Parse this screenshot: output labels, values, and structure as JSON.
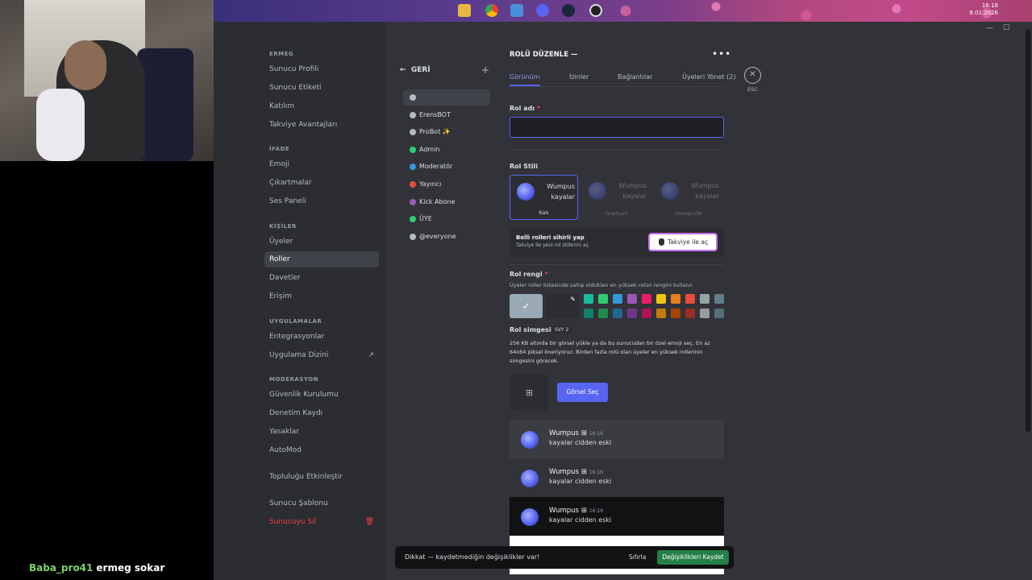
{
  "taskbar": {
    "time": "16:18",
    "date": "8.01.2026"
  },
  "stream": {
    "chat_user": "Baba_pro41",
    "chat_message": "ermeg sokar"
  },
  "sidebar": {
    "sections": [
      {
        "title": "ERMEG",
        "items": [
          "Sunucu Profili",
          "Sunucu Etiketi",
          "Katılım",
          "Takviye Avantajları"
        ]
      },
      {
        "title": "İFADE",
        "items": [
          "Emoji",
          "Çıkartmalar",
          "Ses Paneli"
        ]
      },
      {
        "title": "KİŞİLER",
        "items": [
          "Üyeler",
          "Roller",
          "Davetler",
          "Erişim"
        ]
      },
      {
        "title": "UYGULAMALAR",
        "items": [
          "Entegrasyonlar",
          "Uygulama Dizini"
        ]
      },
      {
        "title": "MODERASYON",
        "items": [
          "Güvenlik Kurulumu",
          "Denetim Kaydı",
          "Yasaklar",
          "AutoMod"
        ]
      },
      {
        "title": "",
        "items": [
          "Topluluğu Etkinleştir"
        ]
      },
      {
        "title": "",
        "items": [
          "Sunucu Şablonu",
          "Sunucuyu Sil"
        ]
      }
    ],
    "active_item": "Roller"
  },
  "roles": {
    "back_label": "GERİ",
    "items": [
      {
        "name": "",
        "color": "#b5bac1"
      },
      {
        "name": "ErensBOT",
        "color": "#b5bac1"
      },
      {
        "name": "ProBot ✨",
        "color": "#b5bac1"
      },
      {
        "name": "Admin",
        "color": "#2ecc71"
      },
      {
        "name": "Moderatör",
        "color": "#3498db"
      },
      {
        "name": "Yayıncı",
        "color": "#e74c3c"
      },
      {
        "name": "Kick Abone",
        "color": "#9b59b6"
      },
      {
        "name": "ÜYE",
        "color": "#2ecc71"
      },
      {
        "name": "@everyone",
        "color": "#b5bac1"
      }
    ]
  },
  "editor": {
    "title": "ROLÜ DÜZENLE —",
    "tabs": [
      "Görünüm",
      "İzinler",
      "Bağlantılar",
      "Üyeleri Yönet (2)"
    ],
    "esc_label": "ESC",
    "role_name_label": "Rol adı",
    "role_name_value": "",
    "role_style_label": "Rol Stili",
    "style_cards": [
      {
        "label": "Katı",
        "line1": "Wumpus",
        "line2": "kayalar"
      },
      {
        "label": "Gradyan",
        "line1": "Wumpus",
        "line2": "kayalar"
      },
      {
        "label": "Holografik",
        "line1": "Wumpus",
        "line2": "kayalar"
      }
    ],
    "boost_title": "Belli rolleri sihirli yap",
    "boost_sub": "Takviye ile yeni rol stillerini aç.",
    "boost_button": "Takviye ile aç",
    "color_label": "Rol rengi",
    "color_desc": "Üyeler roller listesinde sahip oldukları en yüksek rolün rengini kullanır.",
    "swatches_row1": [
      "#1abc9c",
      "#2ecc71",
      "#3498db",
      "#9b59b6",
      "#e91e63",
      "#f1c40f",
      "#e67e22",
      "#e74c3c",
      "#95a5a6",
      "#607d8b"
    ],
    "swatches_row2": [
      "#11806a",
      "#1f8b4c",
      "#206694",
      "#71368a",
      "#ad1457",
      "#c27c0e",
      "#a84300",
      "#992d22",
      "#979c9f",
      "#546e7a"
    ],
    "icon_label": "Rol simgesi",
    "icon_badge": "SVY 2",
    "icon_desc": "256 KB altında bir görsel yükle ya da bu sunucudan bir özel emoji seç. En az 64x64 piksel öneriyoruz. Birden fazla rolü olan üyeler en yüksek rollerinin simgesini görecek.",
    "pick_image_button": "Görsel Seç",
    "previews": [
      {
        "name": "Wumpus",
        "time": "16:16",
        "message": "kayalar cidden eski",
        "bg": "#3a3c42"
      },
      {
        "name": "Wumpus",
        "time": "16:16",
        "message": "kayalar cidden eski",
        "bg": "#313338"
      },
      {
        "name": "Wumpus",
        "time": "16:16",
        "message": "kayalar cidden eski",
        "bg": "#111214"
      }
    ]
  },
  "unsaved_bar": {
    "text": "Dikkat — kaydetmediğin değişiklikler var!",
    "reset": "Sıfırla",
    "save": "Değişiklikleri Kaydet"
  }
}
